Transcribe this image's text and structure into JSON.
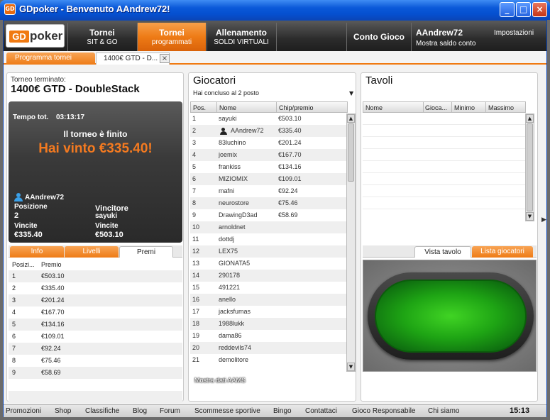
{
  "window": {
    "title": "GDpoker - Benvenuto AAndrew72!",
    "icon": "GD",
    "min": "_",
    "max": "□",
    "close": "×"
  },
  "header": {
    "logo_gd": "GD",
    "logo_poker": "poker",
    "tabs": [
      {
        "l1": "Tornei",
        "l2": "SIT & GO"
      },
      {
        "l1": "Tornei",
        "l2": "programmati"
      },
      {
        "l1": "Allenamento",
        "l2": "SOLDI VIRTUALI"
      },
      {
        "l1": "",
        "l2": ""
      },
      {
        "l1": "Conto Gioco",
        "l2": ""
      }
    ],
    "username": "AAndrew72",
    "settings": "Impostazioni",
    "balance": "Mostra saldo conto"
  },
  "subtabs": {
    "schedule": "Programma tornei",
    "current": "1400€ GTD - D...",
    "close": "×"
  },
  "tournament": {
    "status": "Torneo terminato:",
    "name": "1400€ GTD - DoubleStack",
    "total_time_label": "Tempo tot.",
    "total_time": "03:13:17",
    "finished": "Il torneo è finito",
    "won": "Hai vinto €335.40!",
    "player": "AAndrew72",
    "position_label": "Posizione",
    "position": "2",
    "winnings_label": "Vincite",
    "winnings": "€335.40",
    "winner_label": "Vincitore",
    "winner": "sayuki",
    "winner_winnings_label": "Vincite",
    "winner_winnings": "€503.10"
  },
  "left_tabs": {
    "info": "Info",
    "levels": "Livelli",
    "prizes": "Premi"
  },
  "prizes": {
    "col_pos": "Posizi...",
    "col_prize": "Premio",
    "rows": [
      [
        "1",
        "€503.10"
      ],
      [
        "2",
        "€335.40"
      ],
      [
        "3",
        "€201.24"
      ],
      [
        "4",
        "€167.70"
      ],
      [
        "5",
        "€134.16"
      ],
      [
        "6",
        "€109.01"
      ],
      [
        "7",
        "€92.24"
      ],
      [
        "8",
        "€75.46"
      ],
      [
        "9",
        "€58.69"
      ]
    ]
  },
  "players": {
    "title": "Giocatori",
    "subtitle": "Hai concluso al 2 posto",
    "col_pos": "Pos.",
    "col_name": "Nome",
    "col_chip": "Chip/premio",
    "rows": [
      [
        "1",
        "sayuki",
        "€503.10"
      ],
      [
        "2",
        "AAndrew72",
        "€335.40"
      ],
      [
        "3",
        "83luchino",
        "€201.24"
      ],
      [
        "4",
        "joemix",
        "€167.70"
      ],
      [
        "5",
        "frankiss",
        "€134.16"
      ],
      [
        "6",
        "MIZIOMIX",
        "€109.01"
      ],
      [
        "7",
        "mafni",
        "€92.24"
      ],
      [
        "8",
        "neurostore",
        "€75.46"
      ],
      [
        "9",
        "DrawingD3ad",
        "€58.69"
      ],
      [
        "10",
        "arnoldnet",
        ""
      ],
      [
        "11",
        "dottdj",
        ""
      ],
      [
        "12",
        "LEX75",
        ""
      ],
      [
        "13",
        "GIONATA5",
        ""
      ],
      [
        "14",
        "290178",
        ""
      ],
      [
        "15",
        "491221",
        ""
      ],
      [
        "16",
        "anello",
        ""
      ],
      [
        "17",
        "jacksfumas",
        ""
      ],
      [
        "18",
        "1988lukk",
        ""
      ],
      [
        "19",
        "dama86",
        ""
      ],
      [
        "20",
        "reddevils74",
        ""
      ],
      [
        "21",
        "demolitore",
        ""
      ]
    ],
    "aams": "Mostra dati AAMS"
  },
  "tables": {
    "title": "Tavoli",
    "col_name": "Nome",
    "col_players": "Gioca...",
    "col_min": "Minimo",
    "col_max": "Massimo"
  },
  "right_tabs": {
    "view": "Vista tavolo",
    "list": "Lista giocatori"
  },
  "footer": {
    "links": [
      "Promozioni",
      "Shop",
      "Classifiche",
      "Blog",
      "Forum",
      "Scommesse sportive",
      "Bingo",
      "Contattaci",
      "Gioco Responsabile",
      "Chi siamo"
    ],
    "clock": "15:13"
  },
  "colors": {
    "accent": "#ee7b16",
    "title_bar": "#0a58d8",
    "won": "#f47a20",
    "felt": "#1ea414"
  }
}
